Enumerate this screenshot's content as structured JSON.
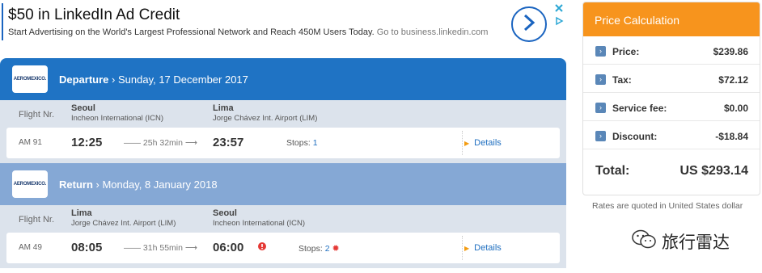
{
  "ad": {
    "title": "$50 in LinkedIn Ad Credit",
    "text": "Start Advertising on the World's Largest Professional Network and Reach 450M Users Today.",
    "url": "Go to business.linkedin.com",
    "arrow_icon": "chevron-right-icon",
    "accent": "#1a64c0"
  },
  "departure": {
    "airline_logo": "AEROMEXICO.",
    "title_bold": "Departure",
    "title_date": " › Sunday, 17 December 2017",
    "flight_label": "Flight Nr.",
    "from_city": "Seoul",
    "from_airport": "Incheon International (ICN)",
    "to_city": "Lima",
    "to_airport": "Jorge Chávez Int. Airport (LIM)",
    "flight_no": "AM 91",
    "dep_time": "12:25",
    "duration": "—— 25h 32min ⟶",
    "arr_time": "23:57",
    "stops_label": "Stops:",
    "stops": "1",
    "details": "Details"
  },
  "return": {
    "airline_logo": "AEROMEXICO.",
    "title_bold": "Return",
    "title_date": " › Monday, 8 January 2018",
    "flight_label": "Flight Nr.",
    "from_city": "Lima",
    "from_airport": "Jorge Chávez Int. Airport (LIM)",
    "to_city": "Seoul",
    "to_airport": "Incheon International (ICN)",
    "flight_no": "AM 49",
    "dep_time": "08:05",
    "duration": "—— 31h 55min ⟶",
    "arr_time": "06:00",
    "stops_label": "Stops:",
    "stops": "2",
    "details": "Details"
  },
  "price": {
    "header": "Price Calculation",
    "rows": [
      {
        "label": "Price:",
        "value": "$239.86"
      },
      {
        "label": "Tax:",
        "value": "$72.12"
      },
      {
        "label": "Service fee:",
        "value": "$0.00"
      },
      {
        "label": "Discount:",
        "value": "-$18.84"
      }
    ],
    "total_label": "Total:",
    "total_value": "US $293.14",
    "note": "Rates are quoted in United States dollar",
    "accent": "#f7941d"
  },
  "watermark": {
    "text": "旅行雷达"
  }
}
